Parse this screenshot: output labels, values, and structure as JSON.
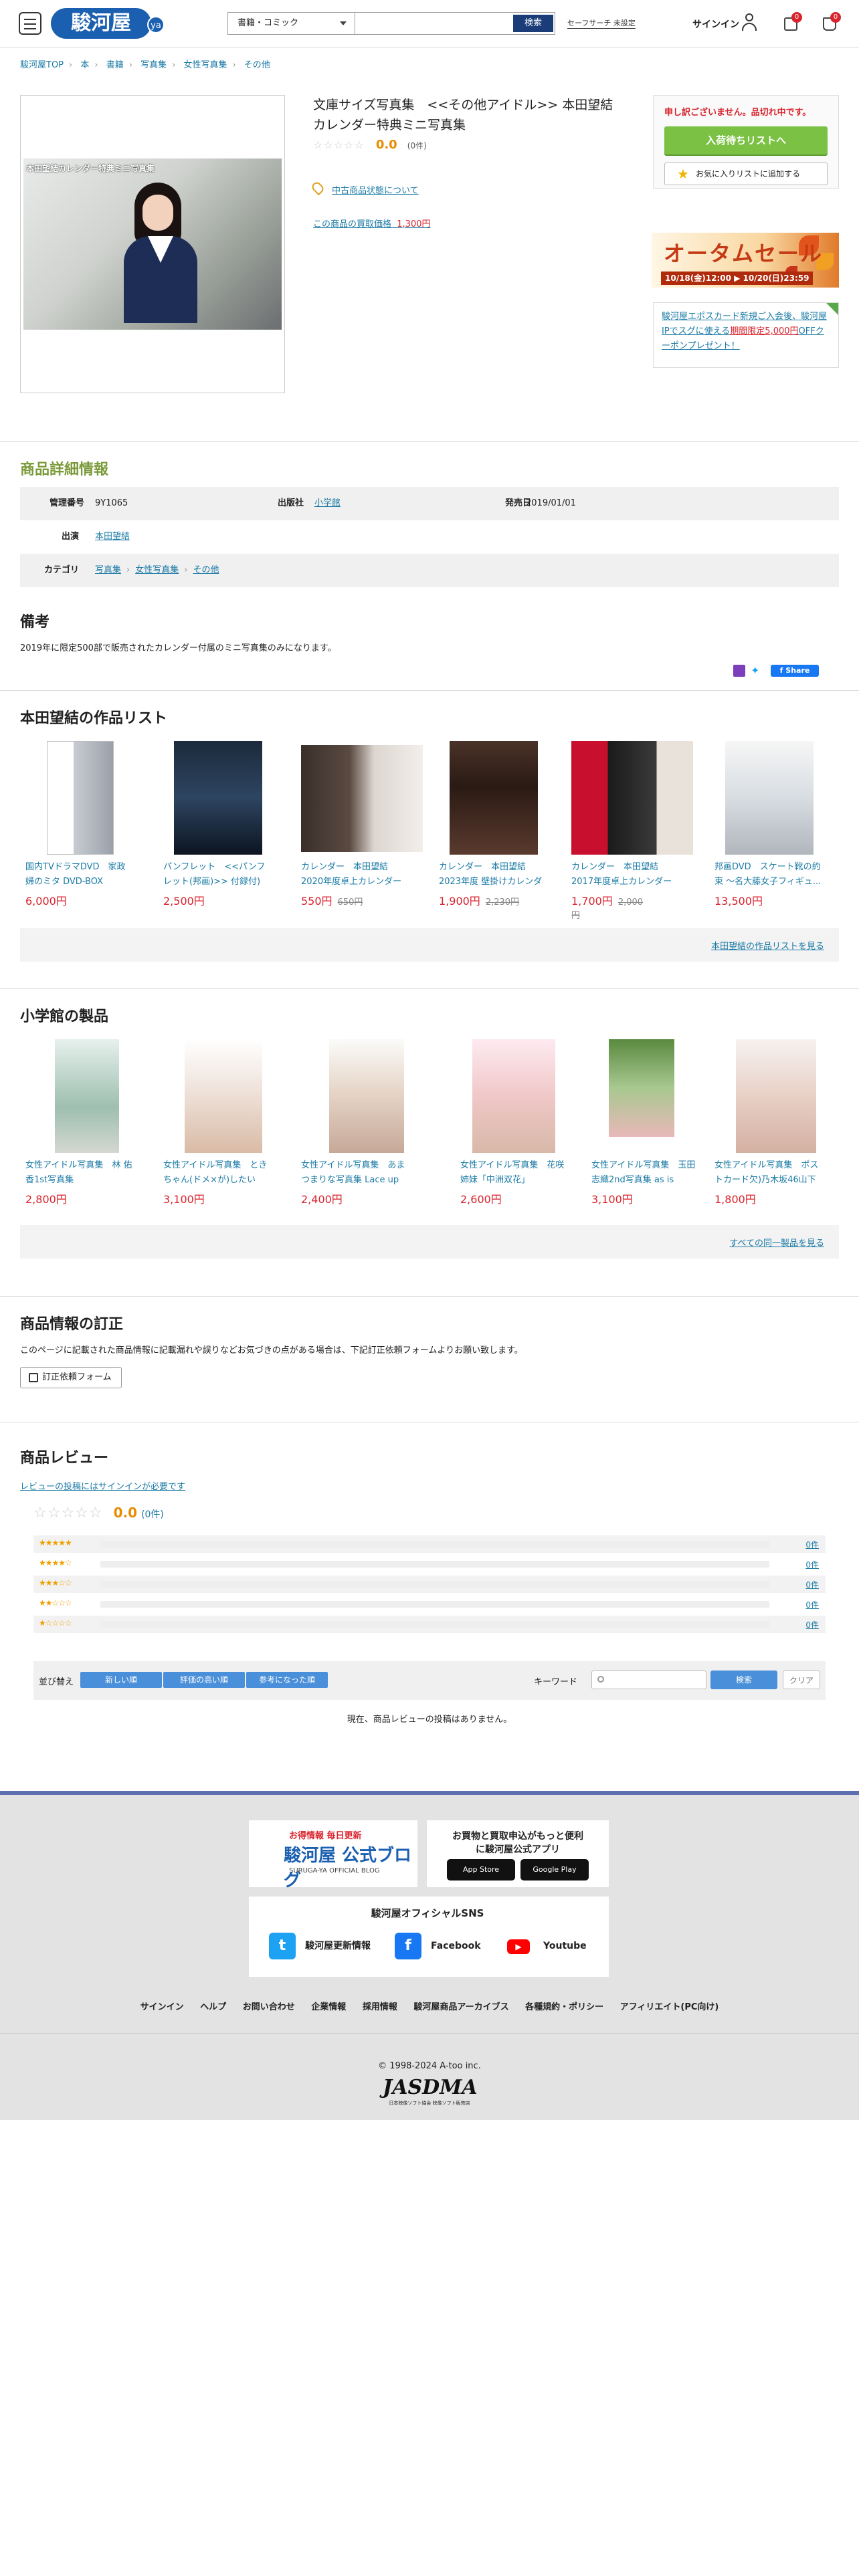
{
  "header": {
    "logo": "駿河屋",
    "logo_suffix": "ya",
    "category": "書籍・コミック",
    "search_button": "検索",
    "safe_search": "セーフサーチ 未設定",
    "signin": "サインイン",
    "cart_count": "0",
    "notice_count": "0"
  },
  "breadcrumb": [
    "駿河屋TOP",
    "本",
    "書籍",
    "写真集",
    "女性写真集",
    "その他"
  ],
  "product": {
    "image_caption": "本田望結カレンダー特典ミニ写真集",
    "title": "文庫サイズ写真集　<<その他アイドル>> 本田望結カレンダー特典ミニ写真集",
    "stars": "☆☆☆☆☆",
    "rating": "0.0",
    "rating_count": "(0件)",
    "used_link": "中古商品状態について",
    "buy_price_label": "この商品の買取価格",
    "buy_price": "1,300円"
  },
  "side": {
    "sorry": "申し訳ございません。品切れ中です。",
    "wishlist_button": "入荷待ちリストへ",
    "favorite_button": "お気に入りリストに追加する",
    "banner_title": "オータムセール",
    "banner_dates": "10/18(金)12:00 ▶ 10/20(日)23:59",
    "card_text_1": "駿河屋エポスカード新規ご入会後、駿河屋IPでスグに使える",
    "card_price": "期間限定5,000円",
    "card_text_2": "OFFクーポンプレゼント！"
  },
  "details": {
    "heading": "商品詳細情報",
    "rows": [
      {
        "label": "管理番号",
        "value": "9Y1065",
        "label2": "出版社",
        "value2": "小学館",
        "label3": "発売日",
        "value3": "2019/01/01"
      },
      {
        "label": "出演",
        "value": "本田望結"
      },
      {
        "label": "カテゴリ",
        "value": "写真集",
        "value_b": "女性写真集",
        "value_c": "その他"
      }
    ]
  },
  "remarks": {
    "heading": "備考",
    "text": "2019年に限定500部で販売されたカレンダー付属のミニ写真集のみになります。",
    "fb_share": "f Share"
  },
  "works": {
    "heading": "本田望結の作品リスト",
    "more": "本田望結の作品リストを見る",
    "items": [
      {
        "name": "国内TVドラマDVD　家政婦のミタ DVD-BOX",
        "price": "6,000円",
        "old": ""
      },
      {
        "name": "パンフレット　<<パンフレット(邦画)>> 付録付)パ...",
        "price": "2,500円",
        "old": ""
      },
      {
        "name": "カレンダー　本田望結 2020年度卓上カレンダー",
        "price": "550円",
        "old": "650円"
      },
      {
        "name": "カレンダー　本田望結 2023年度 壁掛けカレンダー",
        "price": "1,900円",
        "old": "2,230円"
      },
      {
        "name": "カレンダー　本田望結 2017年度卓上カレンダー",
        "price": "1,700円",
        "old": "2,000円"
      },
      {
        "name": "邦画DVD　スケート靴の約束 〜名大藤女子フィギュ...",
        "price": "13,500円",
        "old": ""
      }
    ]
  },
  "publisher": {
    "heading": "小学館の製品",
    "more": "すべての同一製品を見る",
    "items": [
      {
        "name": "女性アイドル写真集　林 佑香1st写真集",
        "price": "2,800円"
      },
      {
        "name": "女性アイドル写真集　ときちゃん(ドメ×が)したい",
        "price": "3,100円"
      },
      {
        "name": "女性アイドル写真集　あまつまりな写真集 Lace up",
        "price": "2,400円"
      },
      {
        "name": "女性アイドル写真集　花咲姉妹「中洲双花」",
        "price": "2,600円"
      },
      {
        "name": "女性アイドル写真集　玉田志織2nd写真集 as is",
        "price": "3,100円"
      },
      {
        "name": "女性アイドル写真集　ポストカード欠)乃木坂46山下美...",
        "price": "1,800円"
      }
    ]
  },
  "correction": {
    "heading": "商品情報の訂正",
    "text": "このページに記載された商品情報に記載漏れや誤りなどお気づきの点がある場合は、下記訂正依頼フォームよりお願い致します。",
    "button": "訂正依頼フォーム"
  },
  "reviews": {
    "heading": "商品レビュー",
    "signin_note": "レビューの投稿にはサインインが必要です",
    "stars": "☆☆☆☆☆",
    "score": "0.0",
    "count": "(0件)",
    "bars": [
      {
        "stars": "★★★★★",
        "count": "0件"
      },
      {
        "stars": "★★★★☆",
        "count": "0件"
      },
      {
        "stars": "★★★☆☆",
        "count": "0件"
      },
      {
        "stars": "★★☆☆☆",
        "count": "0件"
      },
      {
        "stars": "★☆☆☆☆",
        "count": "0件"
      }
    ],
    "sort_label": "並び替え",
    "sort": [
      "新しい順",
      "評価の高い順",
      "参考になった順"
    ],
    "keyword_label": "キーワード",
    "search": "検索",
    "clear": "クリア",
    "none": "現在、商品レビューの投稿はありません。"
  },
  "footer": {
    "blog_t1": "お得情報 毎日更新",
    "blog_t2": "駿河屋 公式ブログ",
    "blog_t3": "SURUGA-YA OFFICIAL BLOG",
    "app_t": "お買物と買取申込がもっと便利\nに駿河屋公式アプリ",
    "appstore": "App Store",
    "googleplay": "Google Play",
    "sns_t": "駿河屋オフィシャルSNS",
    "twitter": "駿河屋更新情報",
    "facebook": "Facebook",
    "youtube": "Youtube",
    "links": [
      "サインイン",
      "ヘルプ",
      "お問い合わせ",
      "企業情報",
      "採用情報",
      "駿河屋商品アーカイブス",
      "各種規約・ポリシー",
      "アフィリエイト(PC向け)"
    ],
    "copy": "© 1998-2024 A-too inc.",
    "jasdma": "JASDMA",
    "jasdma_sub": "日本映像ソフト協会 映像ソフト販売店"
  },
  "colors": {
    "brand": "#1b5fb0",
    "price": "#d9232d",
    "link": "#1a7aa5",
    "wish": "#7ac144"
  }
}
